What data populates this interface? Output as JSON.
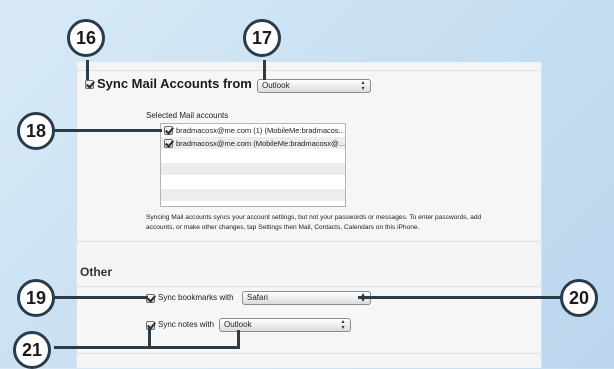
{
  "callouts": {
    "c16": "16",
    "c17": "17",
    "c18": "18",
    "c19": "19",
    "c20": "20",
    "c21": "21"
  },
  "mail": {
    "header_label": "Sync Mail Accounts from",
    "source_select": "Outlook",
    "selected_label": "Selected Mail accounts",
    "accounts": [
      {
        "label": "bradmacosx@me.com (1) (MobileMe:bradmacos...",
        "checked": true
      },
      {
        "label": "bradmacosx@me.com (MobileMe:bradmacosx@...",
        "checked": true
      }
    ],
    "empty_rows": 4,
    "note_line1": "Syncing Mail accounts syncs your account settings, but not your passwords or messages. To enter passwords, add",
    "note_line2": "accounts, or make other changes, tap Settings then Mail, Contacts, Calendars on this iPhone."
  },
  "other": {
    "heading": "Other",
    "bookmarks_label": "Sync bookmarks with",
    "bookmarks_select": "Safari",
    "notes_label": "Sync notes with",
    "notes_select": "Outlook"
  },
  "colors": {
    "background": "#c6def1",
    "callout_border": "#2a3b4a",
    "panel": "#f4f4f4"
  }
}
